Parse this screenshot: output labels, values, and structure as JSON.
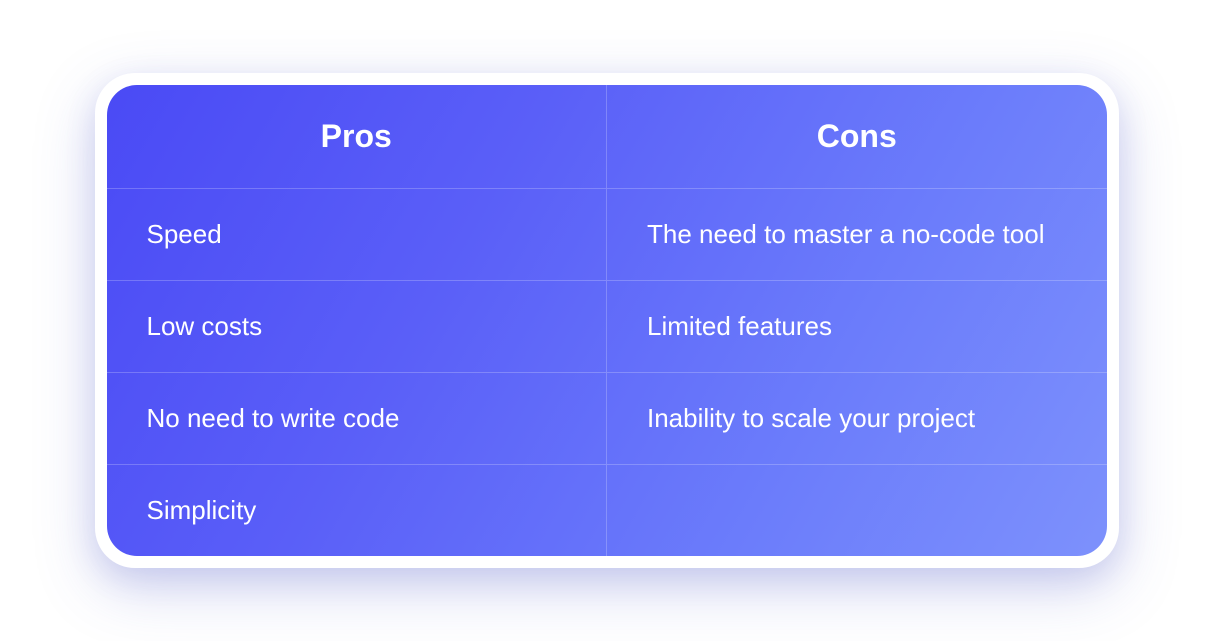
{
  "chart_data": {
    "type": "table",
    "columns": [
      "Pros",
      "Cons"
    ],
    "rows": [
      [
        "Speed",
        "The need to master a no-code tool"
      ],
      [
        "Low costs",
        "Limited features"
      ],
      [
        "No need to write code",
        "Inability to scale your project"
      ],
      [
        "Simplicity",
        ""
      ]
    ]
  },
  "headers": {
    "pros": "Pros",
    "cons": "Cons"
  },
  "rows": [
    {
      "pro": "Speed",
      "con": "The need to master a no-code tool"
    },
    {
      "pro": "Low costs",
      "con": "Limited features"
    },
    {
      "pro": "No need to write code",
      "con": "Inability to scale your project"
    },
    {
      "pro": "Simplicity",
      "con": ""
    }
  ]
}
